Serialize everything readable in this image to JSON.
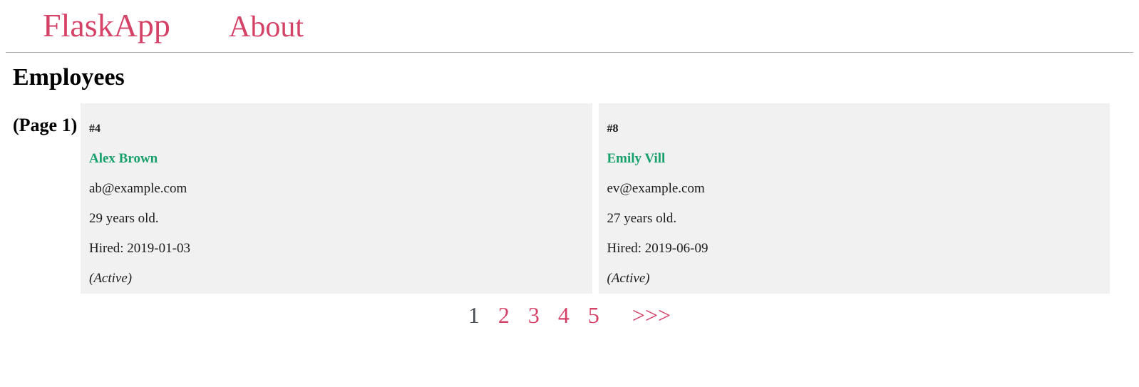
{
  "colors": {
    "brand": "#d54268",
    "link": "#d54268",
    "name_green": "#17a06b",
    "card_bg": "#f1f1f1",
    "current_page": "#4a4f55",
    "rule": "#aaaaac"
  },
  "navbar": {
    "brand": "FlaskApp",
    "about_label": "About"
  },
  "main": {
    "title": "Employees",
    "page_indicator": "(Page 1)"
  },
  "employees": [
    {
      "id": "#4",
      "name": "Alex Brown",
      "email": "ab@example.com",
      "age": "29 years old.",
      "hired": "Hired: 2019-01-03",
      "status": "(Active)"
    },
    {
      "id": "#8",
      "name": "Emily Vill",
      "email": "ev@example.com",
      "age": "27 years old.",
      "hired": "Hired: 2019-06-09",
      "status": "(Active)"
    }
  ],
  "pagination": {
    "pages": [
      {
        "label": "1",
        "current": true
      },
      {
        "label": "2",
        "current": false
      },
      {
        "label": "3",
        "current": false
      },
      {
        "label": "4",
        "current": false
      },
      {
        "label": "5",
        "current": false
      }
    ],
    "next_label": ">>>"
  }
}
